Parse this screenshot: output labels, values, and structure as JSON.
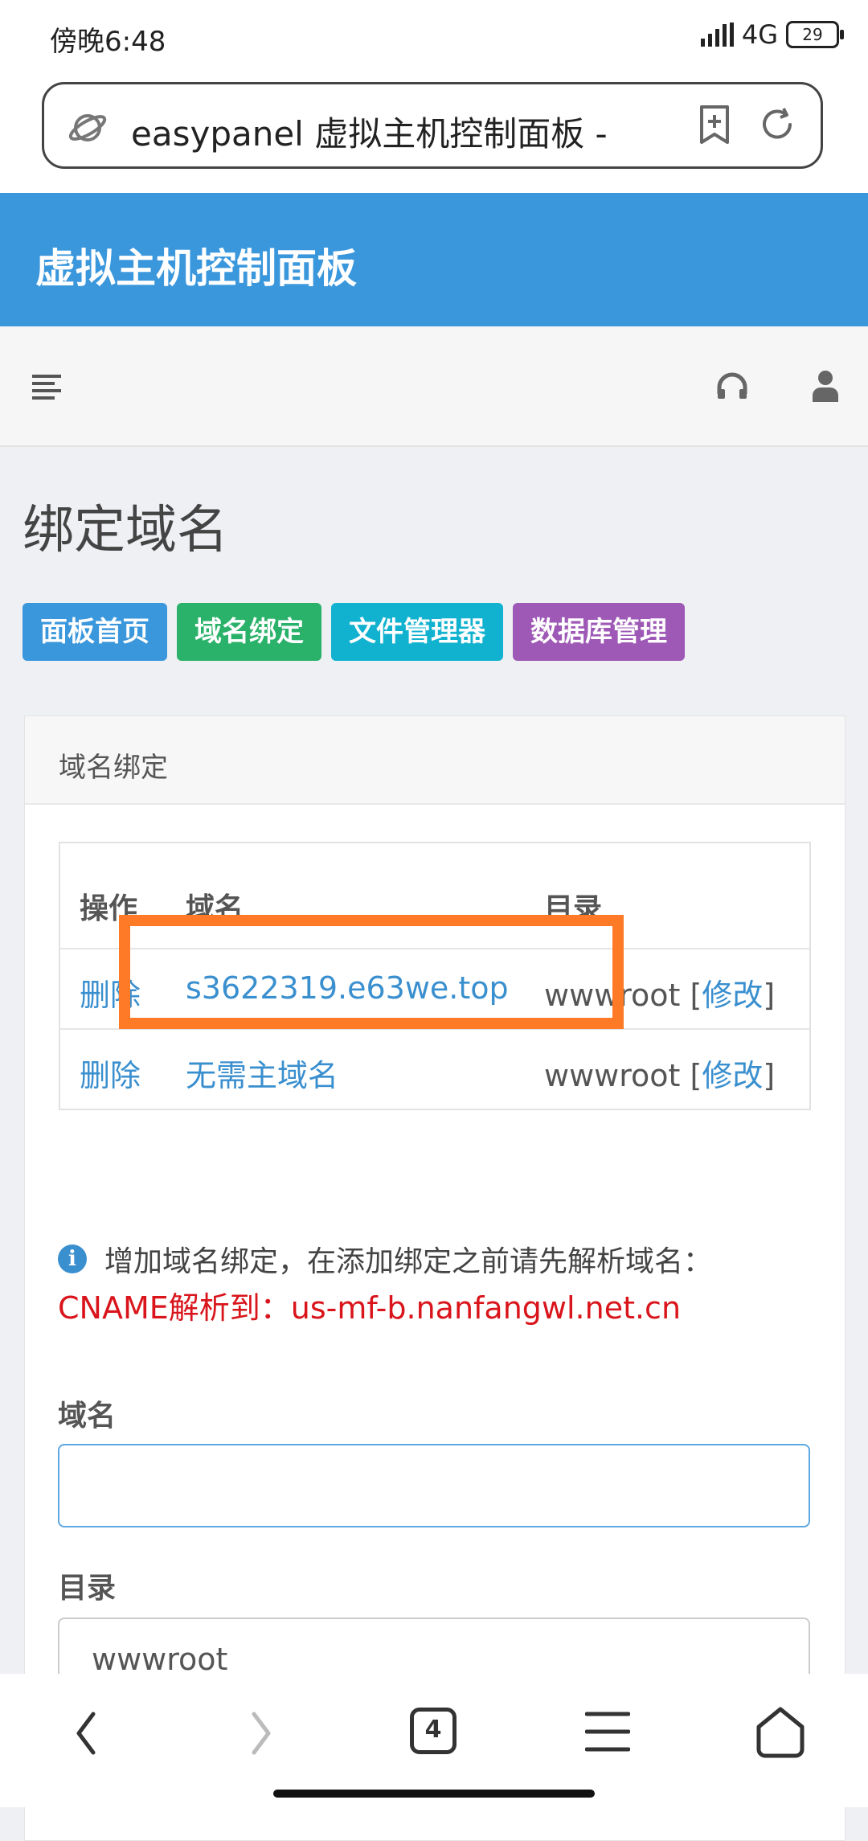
{
  "status_bar": {
    "time": "傍晚6:48",
    "network": "4G",
    "battery": "29"
  },
  "browser": {
    "url_title": "easypanel 虚拟主机控制面板 - ",
    "tab_count": "4"
  },
  "header": {
    "title": "虚拟主机控制面板"
  },
  "page": {
    "title": "绑定域名",
    "nav_buttons": [
      {
        "label": "面板首页",
        "color": "#3a97dc"
      },
      {
        "label": "域名绑定",
        "color": "#2ab26a"
      },
      {
        "label": "文件管理器",
        "color": "#11b2cf"
      },
      {
        "label": "数据库管理",
        "color": "#9e59b6"
      }
    ]
  },
  "card": {
    "title": "域名绑定",
    "table": {
      "headers": [
        "操作",
        "域名",
        "目录"
      ],
      "rows": [
        {
          "action": "删除",
          "domain": "s3622319.e63we.top",
          "dir": "wwwroot",
          "edit": "修改"
        },
        {
          "action": "删除",
          "domain": "无需主域名",
          "dir": "wwwroot",
          "edit": "修改"
        }
      ]
    },
    "info_text": "增加域名绑定，在添加绑定之前请先解析域名：",
    "cname_text": "CNAME解析到：us-mf-b.nanfangwl.net.cn",
    "form": {
      "domain_label": "域名",
      "domain_value": "",
      "dir_label": "目录",
      "dir_value": "wwwroot"
    }
  },
  "highlight_color": "#ff7a26"
}
